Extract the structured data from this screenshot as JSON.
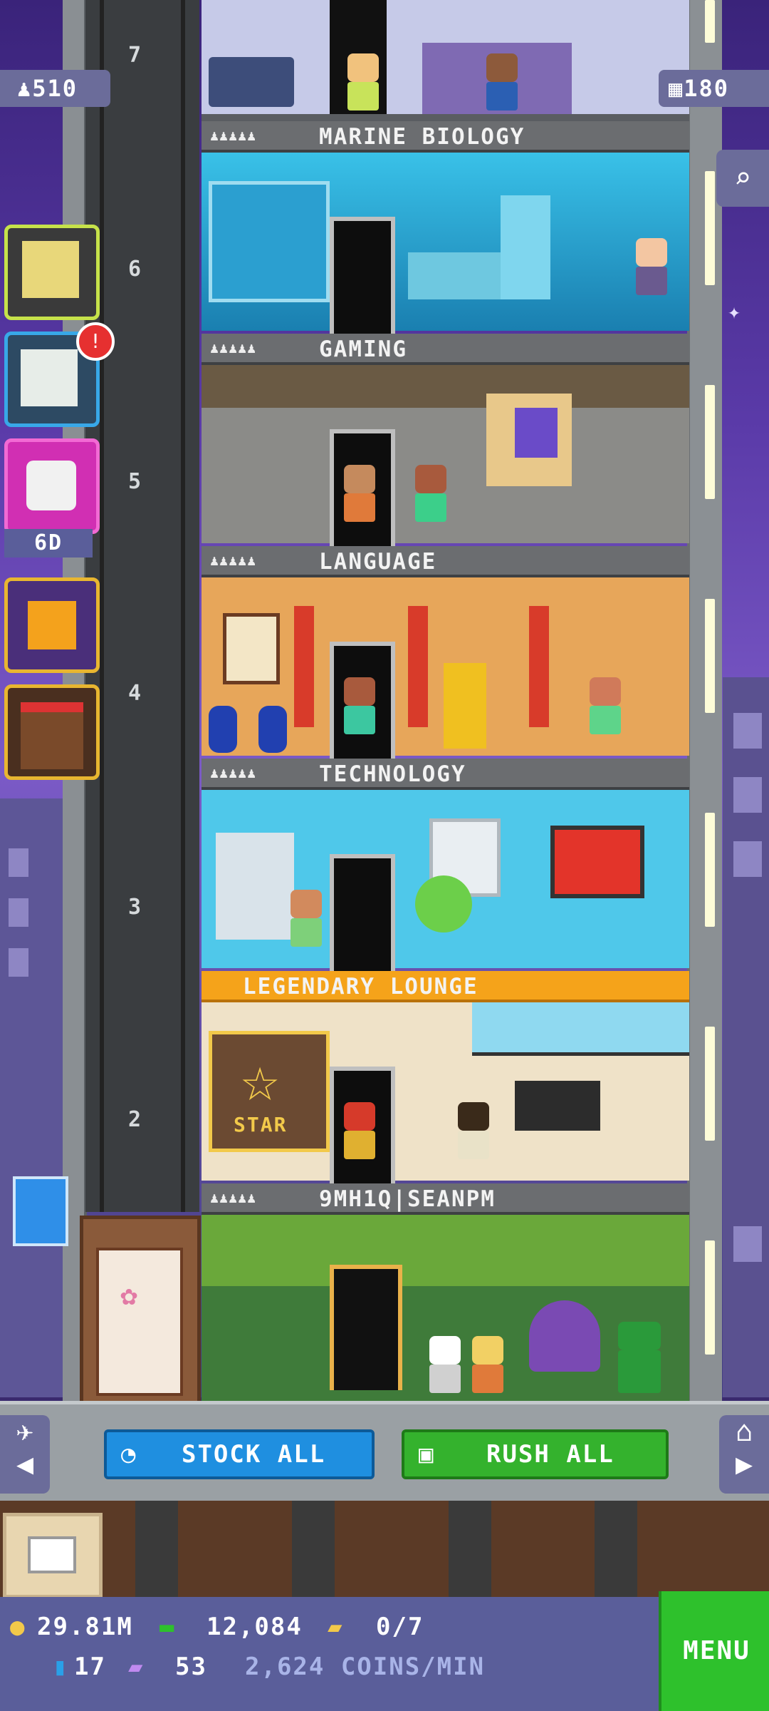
{
  "top_stats": {
    "population": "510",
    "floors": "180"
  },
  "floors": [
    {
      "number": "6",
      "name": "MARINE BIOLOGY"
    },
    {
      "number": "5",
      "name": "GAMING"
    },
    {
      "number": "4",
      "name": "LANGUAGE"
    },
    {
      "number": "3",
      "name": "TECHNOLOGY"
    },
    {
      "number": "2",
      "name": "LEGENDARY LOUNGE"
    },
    {
      "number": "",
      "name": "9MH1Q|SEANPM"
    }
  ],
  "top_floor_number": "7",
  "side_icons": {
    "dice_timer": "6D",
    "notification": "!"
  },
  "actions": {
    "stock_all": "STOCK ALL",
    "rush_all": "RUSH ALL"
  },
  "lounge_sign": "STAR",
  "status": {
    "coins": "29.81M",
    "bux": "12,084",
    "tickets": "0/7",
    "gems": "17",
    "golden_tickets": "53",
    "coins_per_min": "2,624 COINS/MIN"
  },
  "menu_label": "MENU",
  "colors": {
    "accent_blue": "#1f8fe0",
    "accent_green": "#34b22d",
    "lounge_gold": "#f5a31a"
  }
}
